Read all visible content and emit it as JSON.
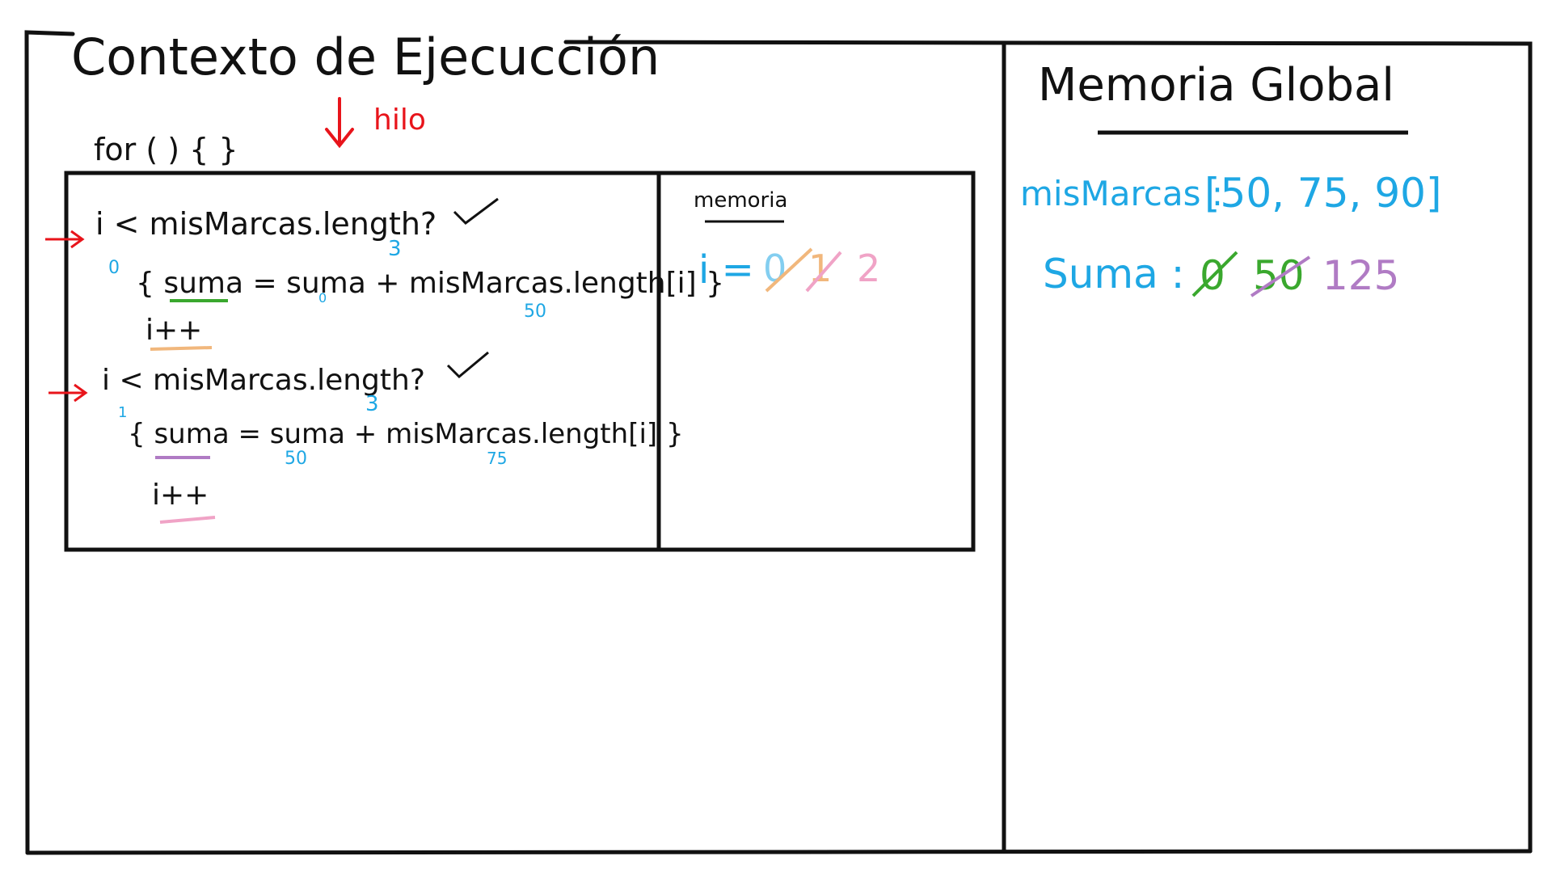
{
  "colors": {
    "ink": "#111111",
    "red": "#e8141b",
    "blue": "#1ea7e4",
    "green": "#3aa82e",
    "orange": "#f1b77c",
    "pink": "#f0a3c6",
    "purple": "#b07bc4"
  },
  "execution_context": {
    "title": "Contexto de Ejecucción",
    "thread_label": "hilo",
    "for_label": "for ( ) { }",
    "code": {
      "iteration1": {
        "condition": "i < misMarcas.length?",
        "i_value": "0",
        "length_value": "3",
        "body": "{ suma = suma + misMarcas.length[i] }",
        "suma_value": "0",
        "element_value": "50",
        "increment": "i++"
      },
      "iteration2": {
        "condition": "i < misMarcas.length?",
        "i_value": "1",
        "length_value": "3",
        "body": "{ suma = suma + misMarcas.length[i] }",
        "suma_value": "50",
        "element_value": "75",
        "increment": "i++"
      }
    },
    "memory": {
      "title": "memoria",
      "var": "i =",
      "values": [
        "0",
        "1",
        "2"
      ]
    }
  },
  "global_memory": {
    "title": "Memoria Global",
    "array_name": "misMarcas :",
    "array_value": "[50, 75, 90]",
    "suma_name": "Suma :",
    "suma_values": [
      "0",
      "50",
      "125"
    ]
  }
}
